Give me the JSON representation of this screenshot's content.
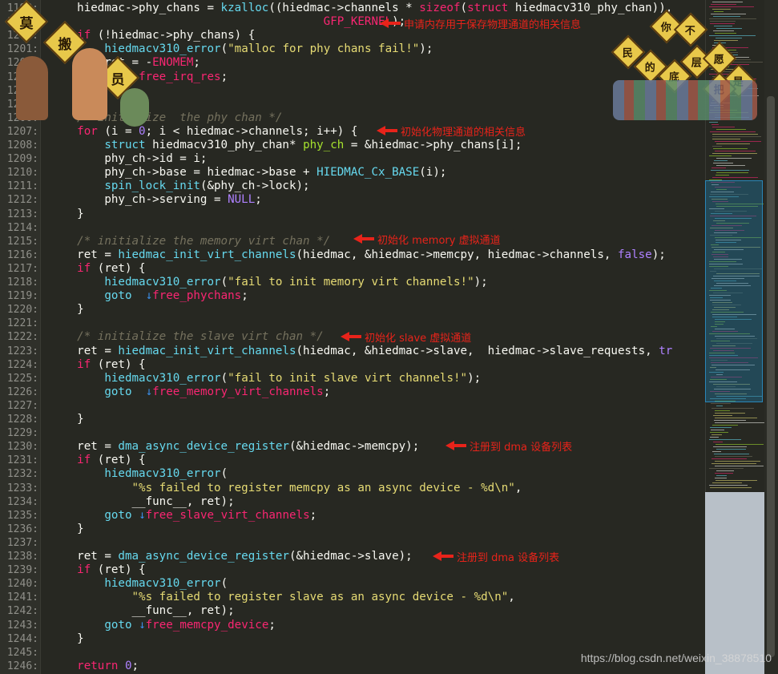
{
  "colors": {
    "background": "#272822",
    "keyword": "#f92672",
    "function": "#66d9ef",
    "string": "#e6db74",
    "number": "#ae81ff",
    "comment": "#75715e",
    "annotation": "#e8231a"
  },
  "lines": [
    {
      "n": "1198:",
      "t": [
        [
          "",
          "    hiedmac->phy_chans = "
        ],
        [
          "fn",
          "kzalloc"
        ],
        [
          "",
          "((hiedmac->channels * "
        ],
        [
          "kw",
          "sizeof"
        ],
        [
          "",
          "("
        ],
        [
          "kw",
          "struct"
        ],
        [
          "",
          " hiedmacv310_phy_chan)),"
        ]
      ]
    },
    {
      "n": "1199:",
      "t": [
        [
          "",
          "                                        "
        ],
        [
          "kw",
          "GFP_KERNEL"
        ],
        [
          "",
          ");"
        ]
      ]
    },
    {
      "n": "1200:",
      "t": [
        [
          "",
          "    "
        ],
        [
          "kw",
          "if"
        ],
        [
          "",
          " (!hiedmac->phy_chans) {"
        ]
      ]
    },
    {
      "n": "1201:",
      "t": [
        [
          "",
          "        "
        ],
        [
          "fn",
          "hiedmacv310_error"
        ],
        [
          "",
          "("
        ],
        [
          "str",
          "\"malloc for phy chans fail!\""
        ],
        [
          "",
          ");"
        ]
      ]
    },
    {
      "n": "1202:",
      "t": [
        [
          "",
          "        ret = -"
        ],
        [
          "kw",
          "ENOMEM"
        ],
        [
          "",
          ";"
        ]
      ]
    },
    {
      "n": "1203:",
      "t": [
        [
          "",
          "        "
        ],
        [
          "fn",
          "goto"
        ],
        [
          "",
          " "
        ],
        [
          "lbl",
          "free_irq_res"
        ],
        [
          "",
          ";"
        ]
      ]
    },
    {
      "n": "1204:",
      "t": [
        [
          "",
          "    }"
        ]
      ]
    },
    {
      "n": "1205:",
      "t": [
        [
          "",
          ""
        ]
      ]
    },
    {
      "n": "1206:",
      "t": [
        [
          "",
          "    "
        ],
        [
          "cm",
          "/* initialize  the phy chan */"
        ]
      ]
    },
    {
      "n": "1207:",
      "t": [
        [
          "",
          "    "
        ],
        [
          "kw",
          "for"
        ],
        [
          "",
          " (i = "
        ],
        [
          "num",
          "0"
        ],
        [
          "",
          "; i < hiedmac->channels; i++) {"
        ]
      ]
    },
    {
      "n": "1208:",
      "t": [
        [
          "",
          "        "
        ],
        [
          "fn",
          "struct"
        ],
        [
          "",
          " hiedmacv310_phy_chan* "
        ],
        [
          "grn",
          "phy_ch"
        ],
        [
          "",
          " = &hiedmac->phy_chans[i];"
        ]
      ]
    },
    {
      "n": "1209:",
      "t": [
        [
          "",
          "        phy_ch->id = i;"
        ]
      ]
    },
    {
      "n": "1210:",
      "t": [
        [
          "",
          "        phy_ch->base = hiedmac->base + "
        ],
        [
          "fn",
          "HIEDMAC_Cx_BASE"
        ],
        [
          "",
          "(i);"
        ]
      ]
    },
    {
      "n": "1211:",
      "t": [
        [
          "",
          "        "
        ],
        [
          "fn",
          "spin_lock_init"
        ],
        [
          "",
          "(&phy_ch->lock);"
        ]
      ]
    },
    {
      "n": "1212:",
      "t": [
        [
          "",
          "        phy_ch->serving = "
        ],
        [
          "num",
          "NULL"
        ],
        [
          "",
          ";"
        ]
      ]
    },
    {
      "n": "1213:",
      "t": [
        [
          "",
          "    }"
        ]
      ]
    },
    {
      "n": "1214:",
      "t": [
        [
          "",
          ""
        ]
      ]
    },
    {
      "n": "1215:",
      "t": [
        [
          "",
          "    "
        ],
        [
          "cm",
          "/* initialize the memory virt chan */"
        ]
      ]
    },
    {
      "n": "1216:",
      "t": [
        [
          "",
          "    ret = "
        ],
        [
          "fn",
          "hiedmac_init_virt_channels"
        ],
        [
          "",
          "(hiedmac, &hiedmac->memcpy, hiedmac->channels, "
        ],
        [
          "num",
          "false"
        ],
        [
          "",
          ");"
        ]
      ]
    },
    {
      "n": "1217:",
      "t": [
        [
          "",
          "    "
        ],
        [
          "kw",
          "if"
        ],
        [
          "",
          " (ret) {"
        ]
      ]
    },
    {
      "n": "1218:",
      "t": [
        [
          "",
          "        "
        ],
        [
          "fn",
          "hiedmacv310_error"
        ],
        [
          "",
          "("
        ],
        [
          "str",
          "\"fail to init memory virt channels!\""
        ],
        [
          "",
          ");"
        ]
      ]
    },
    {
      "n": "1219:",
      "t": [
        [
          "",
          "        "
        ],
        [
          "fn",
          "goto"
        ],
        [
          "",
          "  "
        ],
        [
          "arrow-down",
          "↓"
        ],
        [
          "lbl",
          "free_phychans"
        ],
        [
          "",
          ";"
        ]
      ]
    },
    {
      "n": "1220:",
      "t": [
        [
          "",
          "    }"
        ]
      ]
    },
    {
      "n": "1221:",
      "t": [
        [
          "",
          ""
        ]
      ]
    },
    {
      "n": "1222:",
      "t": [
        [
          "",
          "    "
        ],
        [
          "cm",
          "/* initialize the slave virt chan */"
        ]
      ]
    },
    {
      "n": "1223:",
      "t": [
        [
          "",
          "    ret = "
        ],
        [
          "fn",
          "hiedmac_init_virt_channels"
        ],
        [
          "",
          "(hiedmac, &hiedmac->slave,  hiedmac->slave_requests, "
        ],
        [
          "num",
          "tr"
        ]
      ]
    },
    {
      "n": "1224:",
      "t": [
        [
          "",
          "    "
        ],
        [
          "kw",
          "if"
        ],
        [
          "",
          " (ret) {"
        ]
      ]
    },
    {
      "n": "1225:",
      "t": [
        [
          "",
          "        "
        ],
        [
          "fn",
          "hiedmacv310_error"
        ],
        [
          "",
          "("
        ],
        [
          "str",
          "\"fail to init slave virt channels!\""
        ],
        [
          "",
          ");"
        ]
      ]
    },
    {
      "n": "1226:",
      "t": [
        [
          "",
          "        "
        ],
        [
          "fn",
          "goto"
        ],
        [
          "",
          "  "
        ],
        [
          "arrow-down",
          "↓"
        ],
        [
          "lbl",
          "free_memory_virt_channels"
        ],
        [
          "",
          ";"
        ]
      ]
    },
    {
      "n": "1227:",
      "t": [
        [
          "",
          ""
        ]
      ]
    },
    {
      "n": "1228:",
      "t": [
        [
          "",
          "    }"
        ]
      ]
    },
    {
      "n": "1229:",
      "t": [
        [
          "",
          ""
        ]
      ]
    },
    {
      "n": "1230:",
      "t": [
        [
          "",
          "    ret = "
        ],
        [
          "fn",
          "dma_async_device_register"
        ],
        [
          "",
          "(&hiedmac->memcpy);"
        ]
      ]
    },
    {
      "n": "1231:",
      "t": [
        [
          "",
          "    "
        ],
        [
          "kw",
          "if"
        ],
        [
          "",
          " (ret) {"
        ]
      ]
    },
    {
      "n": "1232:",
      "t": [
        [
          "",
          "        "
        ],
        [
          "fn",
          "hiedmacv310_error"
        ],
        [
          "",
          "("
        ]
      ]
    },
    {
      "n": "1233:",
      "t": [
        [
          "",
          "            "
        ],
        [
          "str",
          "\"%s failed to register memcpy as an async device - %d\\n\""
        ],
        [
          "",
          ","
        ]
      ]
    },
    {
      "n": "1234:",
      "t": [
        [
          "",
          "            __func__, ret);"
        ]
      ]
    },
    {
      "n": "1235:",
      "t": [
        [
          "",
          "        "
        ],
        [
          "fn",
          "goto"
        ],
        [
          "",
          " "
        ],
        [
          "arrow-down",
          "↓"
        ],
        [
          "lbl",
          "free_slave_virt_channels"
        ],
        [
          "",
          ";"
        ]
      ]
    },
    {
      "n": "1236:",
      "t": [
        [
          "",
          "    }"
        ]
      ]
    },
    {
      "n": "1237:",
      "t": [
        [
          "",
          ""
        ]
      ]
    },
    {
      "n": "1238:",
      "t": [
        [
          "",
          "    ret = "
        ],
        [
          "fn",
          "dma_async_device_register"
        ],
        [
          "",
          "(&hiedmac->slave);"
        ]
      ]
    },
    {
      "n": "1239:",
      "t": [
        [
          "",
          "    "
        ],
        [
          "kw",
          "if"
        ],
        [
          "",
          " (ret) {"
        ]
      ]
    },
    {
      "n": "1240:",
      "t": [
        [
          "",
          "        "
        ],
        [
          "fn",
          "hiedmacv310_error"
        ],
        [
          "",
          "("
        ]
      ]
    },
    {
      "n": "1241:",
      "t": [
        [
          "",
          "            "
        ],
        [
          "str",
          "\"%s failed to register slave as an async device - %d\\n\""
        ],
        [
          "",
          ","
        ]
      ]
    },
    {
      "n": "1242:",
      "t": [
        [
          "",
          "            __func__, ret);"
        ]
      ]
    },
    {
      "n": "1243:",
      "t": [
        [
          "",
          "        "
        ],
        [
          "fn",
          "goto"
        ],
        [
          "",
          " "
        ],
        [
          "arrow-down",
          "↓"
        ],
        [
          "lbl",
          "free_memcpy_device"
        ],
        [
          "",
          ";"
        ]
      ]
    },
    {
      "n": "1244:",
      "t": [
        [
          "",
          "    }"
        ]
      ]
    },
    {
      "n": "1245:",
      "t": [
        [
          "",
          ""
        ]
      ]
    },
    {
      "n": "1246:",
      "t": [
        [
          "",
          "    "
        ],
        [
          "kw",
          "return"
        ],
        [
          "",
          " "
        ],
        [
          "num",
          "0"
        ],
        [
          "",
          ";"
        ]
      ]
    }
  ],
  "annotations": {
    "a1": "申请内存用于保存物理通道的相关信息",
    "a2": "初始化物理通道的相关信息",
    "a3": "初始化  memory 虚拟通道",
    "a4": "初始化  slave 虚拟通道",
    "a5": "注册到  dma 设备列表",
    "a6": "注册到  dma 设备列表"
  },
  "sticker_left": [
    "莫",
    "搬",
    "员"
  ],
  "sticker_right": [
    "你",
    "不",
    "民",
    "的",
    "底",
    "层",
    "愿",
    "是",
    "把"
  ],
  "watermark": "https://blog.csdn.net/weixin_38878510"
}
